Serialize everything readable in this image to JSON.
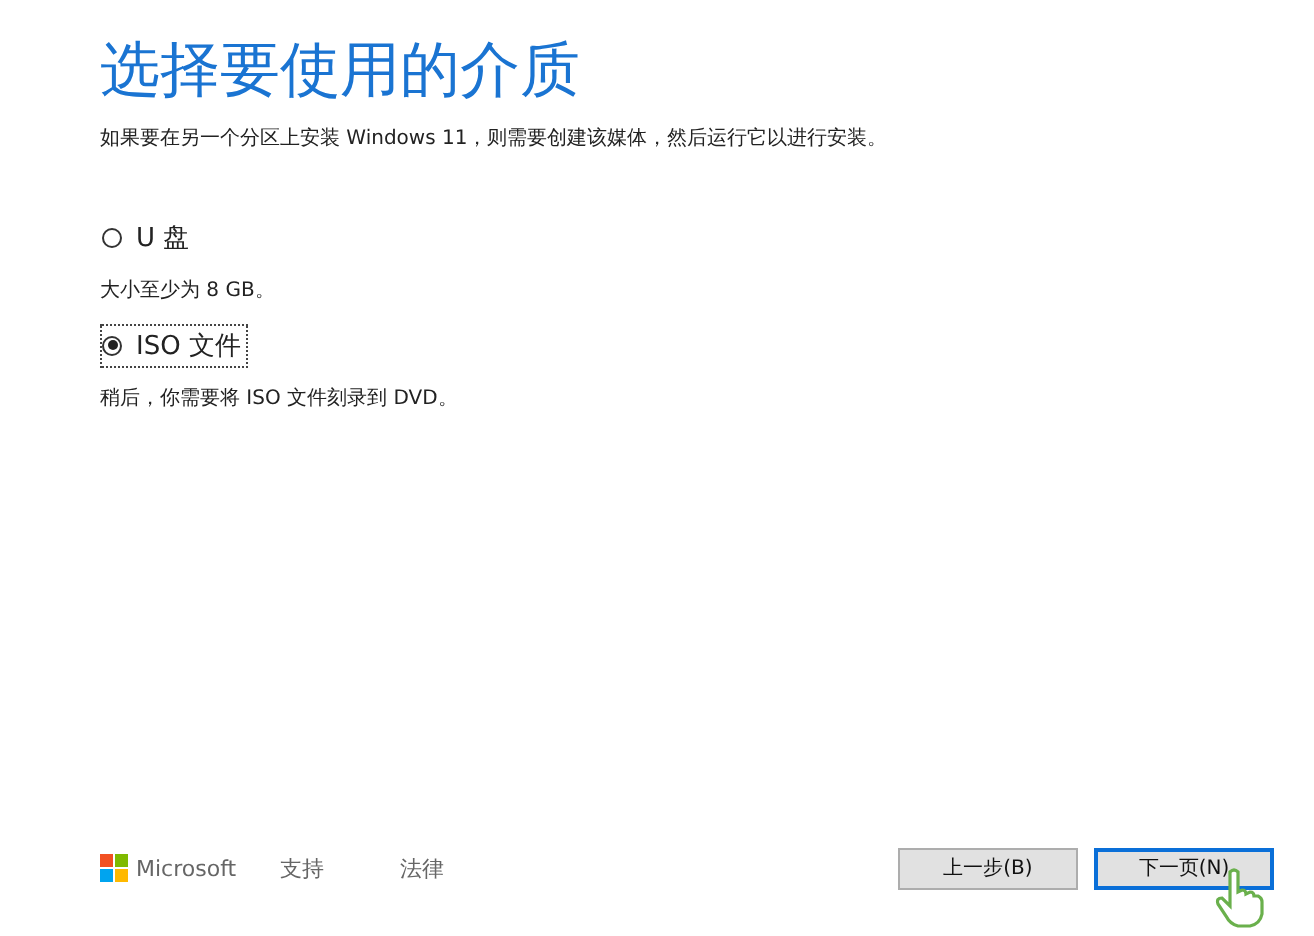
{
  "title": "选择要使用的介质",
  "subtitle": "如果要在另一个分区上安装 Windows 11，则需要创建该媒体，然后运行它以进行安装。",
  "options": [
    {
      "label": "U 盘",
      "description": "大小至少为 8 GB。",
      "selected": false
    },
    {
      "label": "ISO 文件",
      "description": "稍后，你需要将 ISO 文件刻录到 DVD。",
      "selected": true
    }
  ],
  "footer": {
    "brand": "Microsoft",
    "links": [
      "支持",
      "法律"
    ]
  },
  "buttons": [
    {
      "label": "上一步(B)",
      "focused": false
    },
    {
      "label": "下一页(N)",
      "focused": true
    }
  ]
}
